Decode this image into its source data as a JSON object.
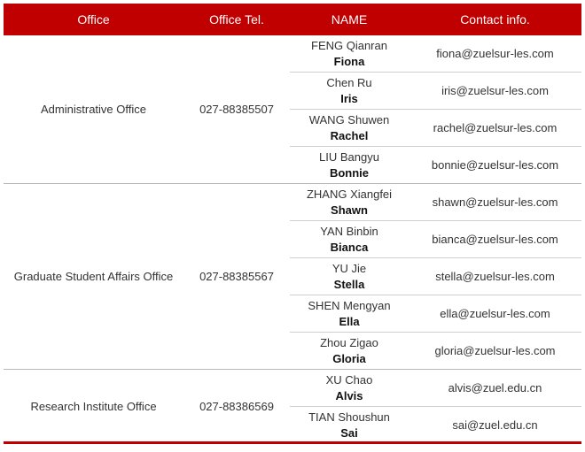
{
  "header": {
    "office": "Office",
    "tel": "Office Tel.",
    "name": "NAME",
    "contact": "Contact info."
  },
  "groups": [
    {
      "office": "Administrative Office",
      "tel": "027-88385507",
      "people": [
        {
          "cn": "FENG Qianran",
          "en": "Fiona",
          "email": "fiona@zuelsur-les.com"
        },
        {
          "cn": "Chen Ru",
          "en": "Iris",
          "email": "iris@zuelsur-les.com"
        },
        {
          "cn": "WANG Shuwen",
          "en": "Rachel",
          "email": "rachel@zuelsur-les.com"
        },
        {
          "cn": "LIU Bangyu",
          "en": "Bonnie",
          "email": "bonnie@zuelsur-les.com"
        }
      ]
    },
    {
      "office": "Graduate Student Affairs Office",
      "tel": "027-88385567",
      "people": [
        {
          "cn": "ZHANG Xiangfei",
          "en": "Shawn",
          "email": "shawn@zuelsur-les.com"
        },
        {
          "cn": "YAN Binbin",
          "en": "Bianca",
          "email": "bianca@zuelsur-les.com"
        },
        {
          "cn": "YU Jie",
          "en": "Stella",
          "email": "stella@zuelsur-les.com"
        },
        {
          "cn": "SHEN Mengyan",
          "en": "Ella",
          "email": "ella@zuelsur-les.com"
        },
        {
          "cn": "Zhou Zigao",
          "en": "Gloria",
          "email": "gloria@zuelsur-les.com"
        }
      ]
    },
    {
      "office": "Research Institute Office",
      "tel": "027-88386569",
      "people": [
        {
          "cn": "XU Chao",
          "en": "Alvis",
          "email": "alvis@zuel.edu.cn"
        },
        {
          "cn": "TIAN Shoushun",
          "en": "Sai",
          "email": "sai@zuel.edu.cn"
        }
      ]
    }
  ],
  "colors": {
    "header_bg": "#c00000",
    "header_text": "#ffffff",
    "rule": "#c00000"
  }
}
